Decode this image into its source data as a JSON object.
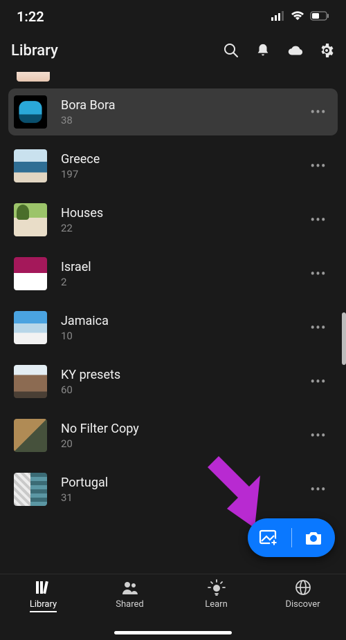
{
  "status": {
    "time": "1:22"
  },
  "header": {
    "title": "Library"
  },
  "albums": [
    {
      "name": "Bora Bora",
      "count": "38",
      "selected": true,
      "thumbClass": "th-bora"
    },
    {
      "name": "Greece",
      "count": "197",
      "selected": false,
      "thumbClass": "th-greece"
    },
    {
      "name": "Houses",
      "count": "22",
      "selected": false,
      "thumbClass": "th-houses"
    },
    {
      "name": "Israel",
      "count": "2",
      "selected": false,
      "thumbClass": "th-israel"
    },
    {
      "name": "Jamaica",
      "count": "10",
      "selected": false,
      "thumbClass": "th-jamaica"
    },
    {
      "name": "KY presets",
      "count": "60",
      "selected": false,
      "thumbClass": "th-ky"
    },
    {
      "name": "No Filter Copy",
      "count": "20",
      "selected": false,
      "thumbClass": "th-nofilter"
    },
    {
      "name": "Portugal",
      "count": "31",
      "selected": false,
      "thumbClass": "th-portugal"
    }
  ],
  "nav": {
    "items": [
      {
        "label": "Library",
        "active": true
      },
      {
        "label": "Shared",
        "active": false
      },
      {
        "label": "Learn",
        "active": false
      },
      {
        "label": "Discover",
        "active": false
      }
    ]
  },
  "colors": {
    "accent": "#0a78ff",
    "arrow": "#b82ad1"
  }
}
